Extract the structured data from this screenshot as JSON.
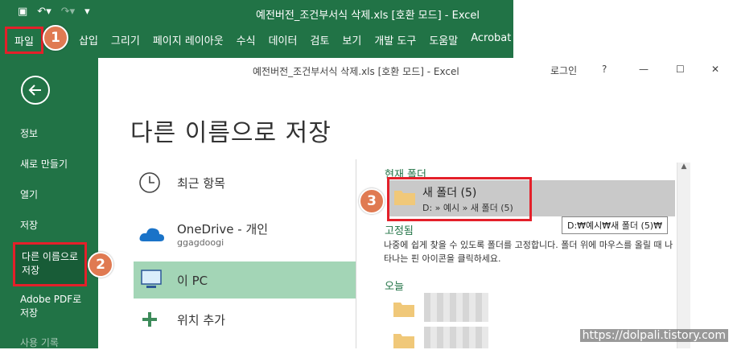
{
  "back_window": {
    "title": "예전버전_조건부서식 삭제.xls [호환 모드] - Excel",
    "tabs": [
      "파일",
      "삽입",
      "그리기",
      "페이지 레이아웃",
      "수식",
      "데이터",
      "검토",
      "보기",
      "개발 도구",
      "도움말",
      "Acrobat"
    ]
  },
  "front_window": {
    "title": "예전버전_조건부서식 삭제.xls [호환 모드] - Excel",
    "signin": "로그인",
    "help": "?"
  },
  "left_nav": {
    "info": "정보",
    "new": "새로 만들기",
    "open": "열기",
    "save": "저장",
    "save_as_1": "다른 이름으로",
    "save_as_2": "저장",
    "adobe_1": "Adobe PDF로",
    "adobe_2": "저장",
    "history": "사용 기록"
  },
  "page_title": "다른 이름으로 저장",
  "locations": {
    "recent": "최근 항목",
    "onedrive": "OneDrive - 개인",
    "onedrive_sub": "ggagdoogi",
    "this_pc": "이 PC",
    "add_place": "위치 추가"
  },
  "right_pane": {
    "current_folder": "현재 폴더",
    "folder_name": "새 폴더 (5)",
    "folder_path": "D: » 예시 » 새 폴더 (5)",
    "tooltip": "D:₩예시₩새 폴더 (5)₩",
    "pinned": "고정됨",
    "pinned_hint": "나중에 쉽게 찾을 수 있도록 폴더를 고정합니다. 폴더 위에 마우스를 올릴 때 나타나는 핀 아이콘을 클릭하세요.",
    "today": "오늘"
  },
  "badges": [
    "1",
    "2",
    "3"
  ],
  "watermark": "https://dolpali.tistory.com",
  "colors": {
    "excel_green": "#217346",
    "highlight": "#e4202a",
    "badge": "#e07a52",
    "selected": "#a3d5b6"
  }
}
